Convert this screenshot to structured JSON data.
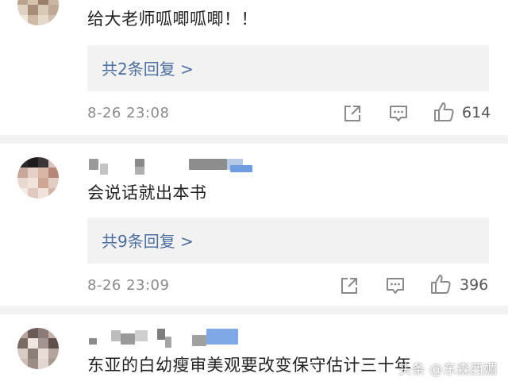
{
  "comments": [
    {
      "text": "给大老师呱唧呱唧！！",
      "replies_label": "共2条回复 >",
      "timestamp": "8-26 23:08",
      "likes": "614"
    },
    {
      "text": "会说话就出本书",
      "replies_label": "共9条回复 >",
      "timestamp": "8-26 23:09",
      "likes": "396"
    },
    {
      "text": "东亚的白幼瘦审美观要改变保守估计三十年"
    }
  ],
  "watermark": "头条 @东森西媚",
  "icons": [
    "share-icon",
    "comment-icon",
    "like-icon"
  ],
  "colors": {
    "link": "#4a6fa0",
    "meta": "#8a8a8a",
    "panel": "#f2f2f2"
  }
}
